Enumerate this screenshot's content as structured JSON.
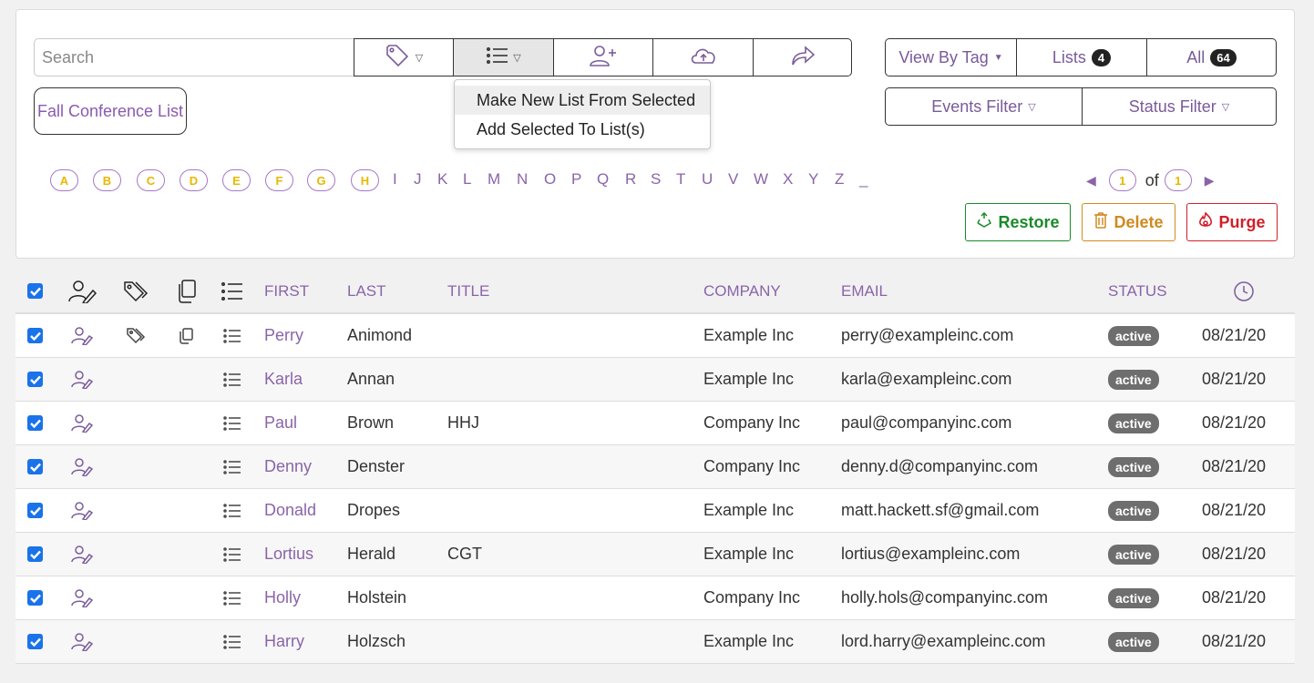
{
  "search": {
    "placeholder": "Search"
  },
  "toolbar": {
    "tag_icon": "tag-icon",
    "list_icon": "list-icon",
    "add_user_icon": "add-user-icon",
    "upload_icon": "cloud-upload-icon",
    "share_icon": "share-icon"
  },
  "list_pill": "Fall Conference List",
  "dropdown": {
    "items": [
      "Make New List From Selected",
      "Add Selected To List(s)"
    ]
  },
  "right": {
    "view_by_tag": "View By Tag",
    "lists_label": "Lists",
    "lists_count": "4",
    "all_label": "All",
    "all_count": "64",
    "events_filter": "Events Filter",
    "status_filter": "Status Filter"
  },
  "alphabet": {
    "circled": [
      "A",
      "B",
      "C",
      "D",
      "E",
      "F",
      "G",
      "H"
    ],
    "plain": [
      "I",
      "J",
      "K",
      "L",
      "M",
      "N",
      "O",
      "P",
      "Q",
      "R",
      "S",
      "T",
      "U",
      "V",
      "W",
      "X",
      "Y",
      "Z",
      "_"
    ]
  },
  "pager": {
    "page": "1",
    "of": "of",
    "total": "1"
  },
  "actions": {
    "restore": "Restore",
    "delete": "Delete",
    "purge": "Purge"
  },
  "colors": {
    "restore": "#1a8a2a",
    "delete": "#d08a20",
    "purge": "#d0202a",
    "accent": "#8a64a8"
  },
  "table": {
    "headers": {
      "first": "FIRST",
      "last": "LAST",
      "title": "TITLE",
      "company": "COMPANY",
      "email": "EMAIL",
      "status": "STATUS"
    },
    "rows": [
      {
        "first": "Perry",
        "last": "Animond",
        "title": "",
        "company": "Example Inc",
        "email": "perry@exampleinc.com",
        "status": "active",
        "date": "08/21/20"
      },
      {
        "first": "Karla",
        "last": "Annan",
        "title": "",
        "company": "Example Inc",
        "email": "karla@exampleinc.com",
        "status": "active",
        "date": "08/21/20"
      },
      {
        "first": "Paul",
        "last": "Brown",
        "title": "HHJ",
        "company": "Company Inc",
        "email": "paul@companyinc.com",
        "status": "active",
        "date": "08/21/20"
      },
      {
        "first": "Denny",
        "last": "Denster",
        "title": "",
        "company": "Company Inc",
        "email": "denny.d@companyinc.com",
        "status": "active",
        "date": "08/21/20"
      },
      {
        "first": "Donald",
        "last": "Dropes",
        "title": "",
        "company": "Example Inc",
        "email": "matt.hackett.sf@gmail.com",
        "status": "active",
        "date": "08/21/20"
      },
      {
        "first": "Lortius",
        "last": "Herald",
        "title": "CGT",
        "company": "Example Inc",
        "email": "lortius@exampleinc.com",
        "status": "active",
        "date": "08/21/20"
      },
      {
        "first": "Holly",
        "last": "Holstein",
        "title": "",
        "company": "Company Inc",
        "email": "holly.hols@companyinc.com",
        "status": "active",
        "date": "08/21/20"
      },
      {
        "first": "Harry",
        "last": "Holzsch",
        "title": "",
        "company": "Example Inc",
        "email": "lord.harry@exampleinc.com",
        "status": "active",
        "date": "08/21/20"
      }
    ]
  }
}
